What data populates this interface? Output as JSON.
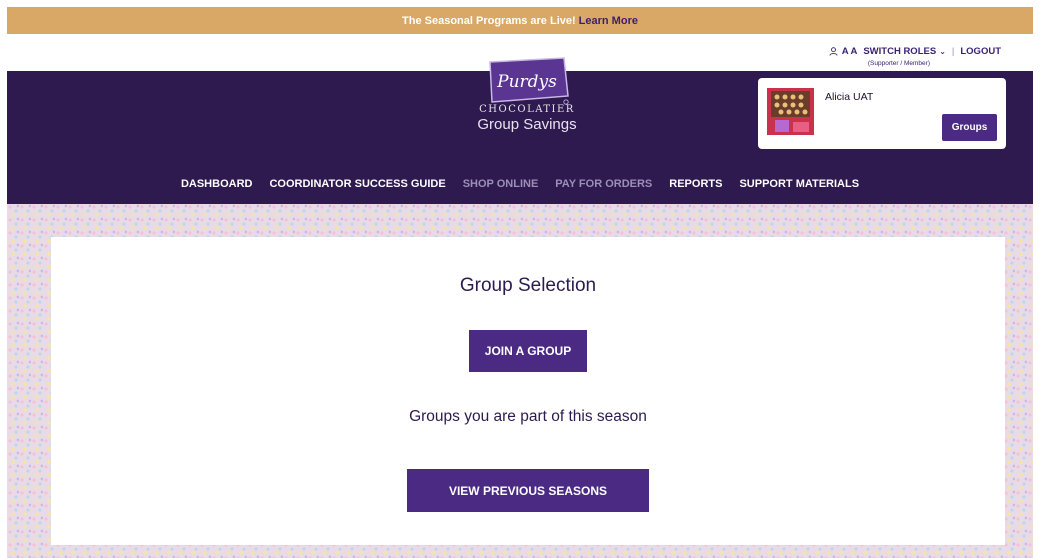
{
  "banner": {
    "text": "The Seasonal Programs are Live!",
    "link": "Learn More"
  },
  "utility": {
    "user_initials": "A A",
    "switch_roles": "SWITCH ROLES",
    "logout": "LOGOUT",
    "role_subtitle": "(Supporter / Member)"
  },
  "logo": {
    "script": "Purdys",
    "line1": "CHOCOLATIER",
    "line2": "Group Savings"
  },
  "user_card": {
    "name": "Alicia UAT",
    "groups_button": "Groups"
  },
  "nav": {
    "items": [
      {
        "label": "DASHBOARD"
      },
      {
        "label": "COORDINATOR SUCCESS GUIDE"
      },
      {
        "label": "SHOP ONLINE"
      },
      {
        "label": "PAY FOR ORDERS"
      },
      {
        "label": "REPORTS"
      },
      {
        "label": "SUPPORT MATERIALS"
      }
    ]
  },
  "main": {
    "title": "Group Selection",
    "join_button": "JOIN A GROUP",
    "groups_text": "Groups you are part of this season",
    "previous_button": "VIEW PREVIOUS SEASONS"
  },
  "colors": {
    "banner": "#d9a866",
    "header": "#2e1a4f",
    "primary_button": "#4b2a84",
    "nav_disabled": "#9d8fb8"
  },
  "icons": [
    "user-icon",
    "chevron-down-icon",
    "purdys-logo",
    "chocolate-box-thumbnail"
  ]
}
